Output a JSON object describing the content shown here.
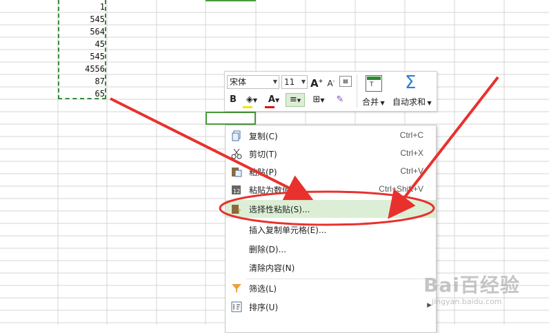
{
  "cells": [
    "1",
    "545",
    "564",
    "45",
    "545",
    "4556",
    "87",
    "65"
  ],
  "toolbar": {
    "font_name": "宋体",
    "font_size": "11",
    "merge_label": "合并",
    "autosum_label": "自动求和",
    "increase_font": "A",
    "decrease_font": "A",
    "bold": "B",
    "font_color": "A"
  },
  "context_menu": {
    "items": [
      {
        "label": "复制(C)",
        "shortcut": "Ctrl+C"
      },
      {
        "label": "剪切(T)",
        "shortcut": "Ctrl+X"
      },
      {
        "label": "粘贴(P)",
        "shortcut": "Ctrl+V"
      },
      {
        "label": "粘贴为数值",
        "shortcut": "Ctrl+Shift+V"
      },
      {
        "label": "选择性粘贴(S)...",
        "shortcut": ""
      },
      {
        "label": "插入复制单元格(E)...",
        "shortcut": ""
      },
      {
        "label": "删除(D)...",
        "shortcut": ""
      },
      {
        "label": "清除内容(N)",
        "shortcut": ""
      },
      {
        "label": "筛选(L)",
        "shortcut": ""
      },
      {
        "label": "排序(U)",
        "shortcut": ""
      }
    ],
    "highlighted_index": 4
  },
  "watermark": {
    "brand": "Bai百经验",
    "url": "jingyan.baidu.com"
  },
  "colors": {
    "copy_border": "#3a8a3a",
    "highlight": "#dcefd6",
    "arrow": "#e8312c",
    "selection": "#4a9a3a"
  }
}
